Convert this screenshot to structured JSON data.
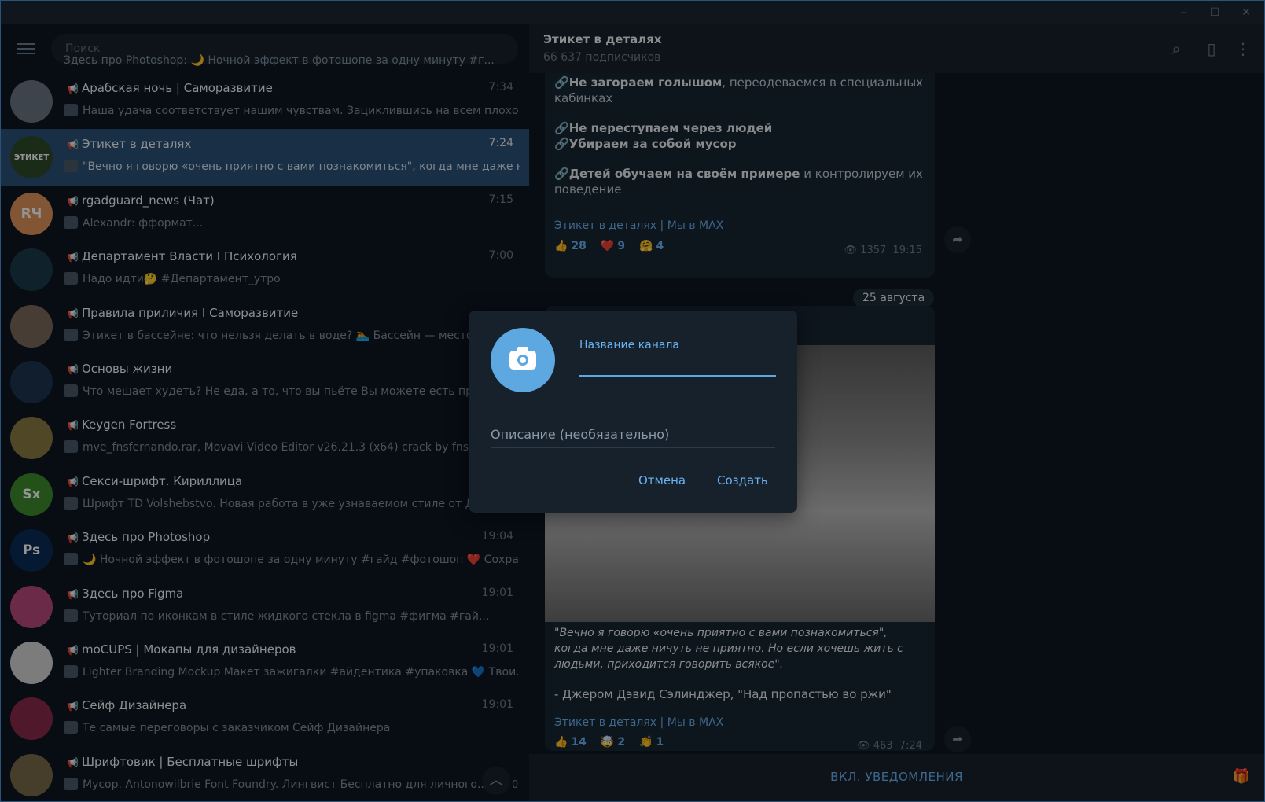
{
  "window": {
    "minimize": "–",
    "maximize": "☐",
    "close": "✕"
  },
  "search": {
    "placeholder": "Поиск"
  },
  "chats": [
    {
      "name": "Арабская ночь | Саморазвитие",
      "time": "7:34",
      "preview": "Наша удача соответствует нашим чувствам. Зациклившись на всем плохо...",
      "avatar_text": "",
      "avatar_color": "#6b7684",
      "active": false
    },
    {
      "name": "Этикет в деталях",
      "time": "7:24",
      "preview": "\"Вечно я говорю «очень приятно с вами познакомиться\", когда мне даже нич...",
      "avatar_text": "ЭТИКЕТ",
      "avatar_color": "#2d4d2a",
      "active": true
    },
    {
      "name": "rgadguard_news (Чат)",
      "time": "7:15",
      "preview": "Alexandr: фформат...",
      "avatar_text": "RЧ",
      "avatar_color": "#e0935a",
      "active": false
    },
    {
      "name": "Департамент Власти I Психология",
      "time": "7:00",
      "preview": "Надо идти🤔 #Департамент_утро",
      "avatar_text": "",
      "avatar_color": "#1a3c4a",
      "active": false
    },
    {
      "name": "Правила приличия I Саморазвитие",
      "time": "",
      "preview": "Этикет в бассейне: что нельзя делать в воде? 🏊 Бассейн — место о...",
      "avatar_text": "",
      "avatar_color": "#7c6a5a",
      "active": false
    },
    {
      "name": "Основы жизни",
      "time": "",
      "preview": "Что мешает худеть? Не еда, а то, что вы пьёте  Вы можете есть прав...",
      "avatar_text": "",
      "avatar_color": "#1c3550",
      "active": false
    },
    {
      "name": "Keygen Fortress",
      "time": "",
      "preview": "mve_fnsfernando.rar, Movavi Video Editor v26.21.3 (x64) crack by fnsfer...",
      "avatar_text": "",
      "avatar_color": "#8a7a44",
      "active": false
    },
    {
      "name": "Секси-шрифт. Кириллица",
      "time": "",
      "preview": "Шрифт TD Volshebstvo. Новая работа в уже узнаваемом стиле от Дми...",
      "avatar_text": "Sx",
      "avatar_color": "#3f8a2d",
      "active": false
    },
    {
      "name": "Здесь про Photoshop",
      "time": "19:04",
      "preview": "🌙 Ночной эффект в фотошопе за одну минуту #гайд #фотошоп  ❤️ Сохра...",
      "avatar_text": "Ps",
      "avatar_color": "#0b2b57",
      "active": false
    },
    {
      "name": "Здесь про Figma",
      "time": "19:01",
      "preview": "Туториал по иконкам в стиле жидкого стекла в figma #фигма #гай...",
      "avatar_text": "",
      "avatar_color": "#b84a7d",
      "active": false
    },
    {
      "name": "moCUPS | Мокапы для дизайнеров",
      "time": "19:01",
      "preview": "Lighter Branding Mockup  Макет зажигалки  #айдентика #упаковка  💙 Твои...",
      "avatar_text": "",
      "avatar_color": "#d6d6d6",
      "active": false
    },
    {
      "name": "Сейф Дизайнера",
      "time": "19:01",
      "preview": "Те самые переговоры с заказчиком  Сейф Дизайнера",
      "avatar_text": "",
      "avatar_color": "#8a2a4a",
      "active": false
    },
    {
      "name": "Шрифтовик | Бесплатные шрифты",
      "time": "",
      "preview": "Мусор. Antonowilbrie Font Foundry. Лингвист Бесплатно для личного...",
      "avatar_text": "",
      "avatar_color": "#7a6a4a",
      "active": false
    }
  ],
  "top_partial": {
    "preview": "Здесь про Photoshop: 🌙 Ночной эффект в фотошопе за одну минуту #г..."
  },
  "scroll": {
    "count": "0"
  },
  "header": {
    "title": "Этикет в деталях",
    "subtitle": "66 637 подписчиков"
  },
  "post1": {
    "l1_bold": "Не загораем голышом",
    "l1_rest": ", переодеваемся в специальных кабинках",
    "l2": "Не переступаем через людей",
    "l3": "Убираем за собой мусор",
    "l4_bold": "Детей обучаем на своём примере",
    "l4_rest": " и контролируем их поведение",
    "link": "Этикет в деталях | Мы в MAX",
    "reactions": [
      {
        "emoji": "👍",
        "count": "28"
      },
      {
        "emoji": "❤️",
        "count": "9"
      },
      {
        "emoji": "🤗",
        "count": "4"
      }
    ],
    "views": "1357",
    "time": "19:15"
  },
  "date_pill": "25 августа",
  "post2": {
    "quote": "\"Вечно я говорю «очень приятно с вами познакомиться\", когда мне даже ничуть не приятно. Но если хочешь жить с людьми, приходится говорить всякое\".",
    "author": "- Джером Дэвид Сэлинджер, \"Над пропастью во ржи\"",
    "link": "Этикет в деталях | Мы в MAX",
    "reactions": [
      {
        "emoji": "👍",
        "count": "14"
      },
      {
        "emoji": "🤯",
        "count": "2"
      },
      {
        "emoji": "👏",
        "count": "1"
      }
    ],
    "views": "463",
    "time": "7:24"
  },
  "bottom": {
    "notify": "ВКЛ. УВЕДОМЛЕНИЯ"
  },
  "dialog": {
    "name_label": "Название канала",
    "name_value": "",
    "desc_placeholder": "Описание (необязательно)",
    "cancel": "Отмена",
    "create": "Создать"
  }
}
